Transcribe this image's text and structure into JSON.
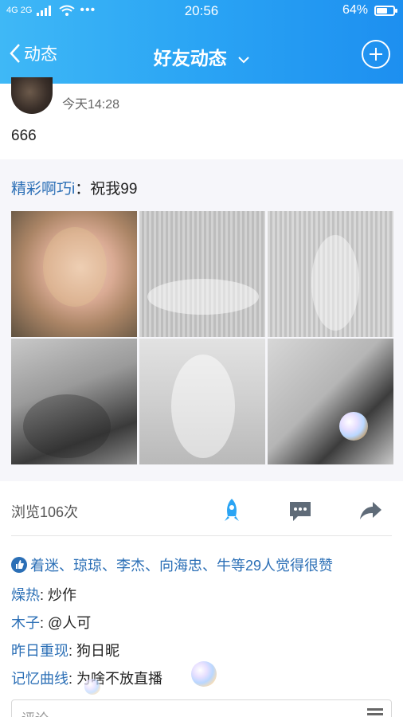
{
  "status_bar": {
    "signal": "4G 2G",
    "time": "20:56",
    "battery_percent": "64%",
    "battery_level": 0.64
  },
  "nav": {
    "back_label": "动态",
    "title": "好友动态"
  },
  "post": {
    "timestamp": "今天14:28",
    "text": "666",
    "forward": {
      "author": "精彩啊巧i",
      "separator": "：",
      "text": "祝我99"
    }
  },
  "stats": {
    "views": "浏览106次"
  },
  "likes": {
    "text": "着迷、琼琼、李杰、向海忠、牛等29人觉得很赞"
  },
  "comments": [
    {
      "author": "燥热",
      "text": "炒作"
    },
    {
      "author": "木子",
      "text": "@人可"
    },
    {
      "author": "昨日重现",
      "text": "狗日昵"
    },
    {
      "author": "记忆曲线",
      "text": "为啥不放直播"
    }
  ],
  "comment_input": {
    "placeholder": "评论"
  },
  "colors": {
    "header_start": "#3fb8f6",
    "header_end": "#1d8ff0",
    "link": "#2b6fb6",
    "rocket": "#2aa4f4"
  }
}
